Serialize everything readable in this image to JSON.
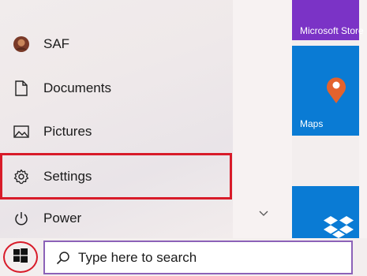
{
  "menu": {
    "items": [
      {
        "label": "SAF",
        "icon": "user-avatar"
      },
      {
        "label": "Documents",
        "icon": "document-icon"
      },
      {
        "label": "Pictures",
        "icon": "pictures-icon"
      },
      {
        "label": "Settings",
        "icon": "gear-icon"
      },
      {
        "label": "Power",
        "icon": "power-icon"
      }
    ]
  },
  "tiles": {
    "store_label": "Microsoft Store",
    "maps_label": "Maps",
    "dropbox_icon": "dropbox-icon"
  },
  "taskbar": {
    "search_placeholder": "Type here to search",
    "start_icon": "windows-logo-icon"
  },
  "colors": {
    "highlight": "#d81b29",
    "store_tile": "#7b33c6",
    "tile_blue": "#0a7bd4",
    "search_border": "#8c62b8",
    "maps_pin": "#e3622d"
  }
}
